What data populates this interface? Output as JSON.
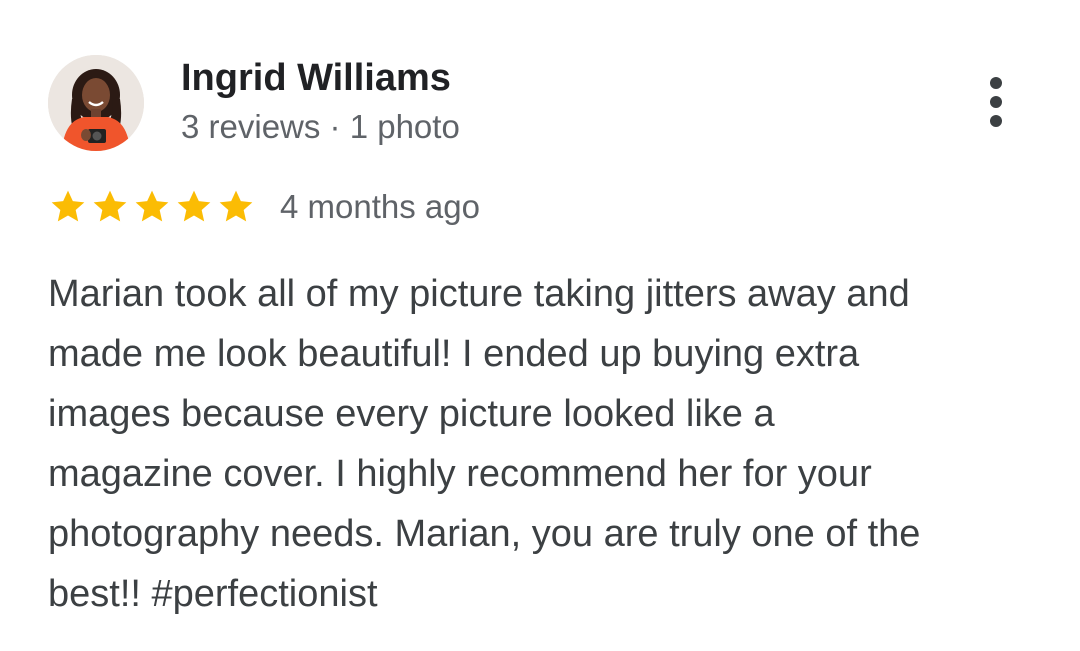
{
  "reviewer": {
    "name": "Ingrid Williams",
    "meta": "3 reviews · 1 photo",
    "avatar_icon": "profile-photo"
  },
  "review": {
    "rating": 5,
    "max_rating": 5,
    "date": "4 months ago",
    "text_lines": [
      "Marian took all of my picture taking jitters away and",
      "made me look beautiful! I ended up buying extra",
      "images because every picture looked like a",
      "magazine cover. I highly recommend her for your",
      "photography needs. Marian, you are truly one of the",
      "best!! #perfectionist"
    ]
  },
  "more_button_icon": "more-vert-icon",
  "colors": {
    "star": "#FBBC04",
    "name": "#202124",
    "meta": "#5f6368",
    "body": "#3c4043"
  }
}
